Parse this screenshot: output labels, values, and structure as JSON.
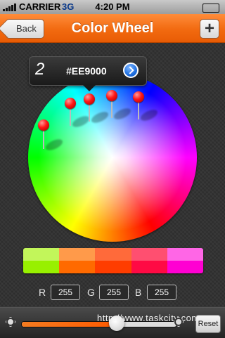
{
  "status_bar": {
    "carrier": "CARRIER",
    "network": "3G",
    "time": "4:20 PM",
    "battery_level": 1.0
  },
  "nav": {
    "back_label": "Back",
    "title": "Color Wheel",
    "add_label": "+"
  },
  "selected_color": {
    "index": "2",
    "hex": "#EE9000"
  },
  "palette": {
    "top": [
      "#c2f65a",
      "#ff9a4a",
      "#ff6a3a",
      "#ff4f70",
      "#ff66e6"
    ],
    "bottom": [
      "#98f000",
      "#ff6a00",
      "#ff3d00",
      "#ff0a44",
      "#ff00d2"
    ]
  },
  "rgb": {
    "r_label": "R",
    "r_value": "255",
    "g_label": "G",
    "g_value": "255",
    "b_label": "B",
    "b_value": "255"
  },
  "toolbar": {
    "brightness": 0.62,
    "watermark": "http://www.taskcity.com",
    "reset_label": "Reset"
  },
  "colors": {
    "nav_orange": "#f26a10",
    "slider_fill": "#f47b20"
  },
  "icons": [
    "signal-icon",
    "battery-icon",
    "back-arrow-icon",
    "add-icon",
    "chevron-right-icon",
    "sun-dim-icon",
    "sun-bright-icon"
  ]
}
